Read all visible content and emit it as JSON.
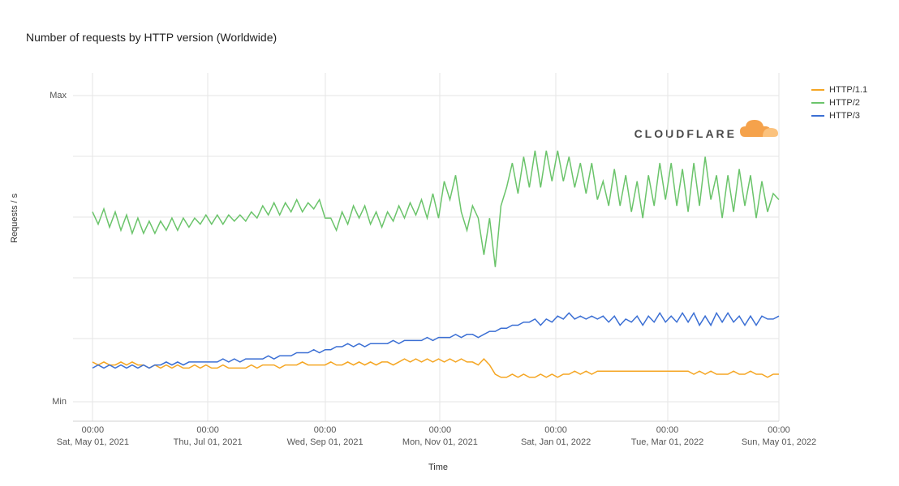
{
  "chart_data": {
    "type": "line",
    "title": "Number of requests by HTTP version (Worldwide)",
    "xlabel": "Time",
    "ylabel": "Requests / s",
    "ylim": [
      0,
      100
    ],
    "y_tick_labels": [
      "Min",
      "Max"
    ],
    "x_tick_labels": [
      {
        "time": "00:00",
        "date": "Sat, May 01, 2021"
      },
      {
        "time": "00:00",
        "date": "Thu, Jul 01, 2021"
      },
      {
        "time": "00:00",
        "date": "Wed, Sep 01, 2021"
      },
      {
        "time": "00:00",
        "date": "Mon, Nov 01, 2021"
      },
      {
        "time": "00:00",
        "date": "Sat, Jan 01, 2022"
      },
      {
        "time": "00:00",
        "date": "Tue, Mar 01, 2022"
      },
      {
        "time": "00:00",
        "date": "Sun, May 01, 2022"
      }
    ],
    "series": [
      {
        "name": "HTTP/1.1",
        "color": "#f5a623",
        "values": [
          13,
          12,
          13,
          12,
          12,
          13,
          12,
          13,
          12,
          12,
          11,
          12,
          11,
          12,
          11,
          12,
          11,
          11,
          12,
          11,
          12,
          11,
          11,
          12,
          11,
          11,
          11,
          11,
          12,
          11,
          12,
          12,
          12,
          11,
          12,
          12,
          12,
          13,
          12,
          12,
          12,
          12,
          13,
          12,
          12,
          13,
          12,
          13,
          12,
          13,
          12,
          13,
          13,
          12,
          13,
          14,
          13,
          14,
          13,
          14,
          13,
          14,
          13,
          14,
          13,
          14,
          13,
          13,
          12,
          14,
          12,
          9,
          8,
          8,
          9,
          8,
          9,
          8,
          8,
          9,
          8,
          9,
          8,
          9,
          9,
          10,
          9,
          10,
          9,
          10,
          10,
          10,
          10,
          10,
          10,
          10,
          10,
          10,
          10,
          10,
          10,
          10,
          10,
          10,
          10,
          10,
          9,
          10,
          9,
          10,
          9,
          9,
          9,
          10,
          9,
          9,
          10,
          9,
          9,
          8,
          9,
          9
        ]
      },
      {
        "name": "HTTP/2",
        "color": "#6bc46b",
        "values": [
          62,
          58,
          63,
          57,
          62,
          56,
          61,
          55,
          60,
          55,
          59,
          55,
          59,
          56,
          60,
          56,
          60,
          57,
          60,
          58,
          61,
          58,
          61,
          58,
          61,
          59,
          61,
          59,
          62,
          60,
          64,
          61,
          65,
          61,
          65,
          62,
          66,
          62,
          65,
          63,
          66,
          60,
          60,
          56,
          62,
          58,
          64,
          60,
          64,
          58,
          62,
          57,
          62,
          59,
          64,
          60,
          65,
          61,
          66,
          60,
          68,
          60,
          72,
          66,
          74,
          62,
          56,
          64,
          60,
          48,
          60,
          44,
          64,
          70,
          78,
          68,
          80,
          70,
          82,
          70,
          82,
          72,
          82,
          72,
          80,
          70,
          78,
          68,
          78,
          66,
          72,
          64,
          76,
          64,
          74,
          62,
          72,
          60,
          74,
          64,
          78,
          66,
          78,
          64,
          76,
          62,
          78,
          64,
          80,
          66,
          74,
          60,
          74,
          62,
          76,
          64,
          74,
          60,
          72,
          62,
          68,
          66
        ]
      },
      {
        "name": "HTTP/3",
        "color": "#3b6fd4",
        "values": [
          11,
          12,
          11,
          12,
          11,
          12,
          11,
          12,
          11,
          12,
          11,
          12,
          12,
          13,
          12,
          13,
          12,
          13,
          13,
          13,
          13,
          13,
          13,
          14,
          13,
          14,
          13,
          14,
          14,
          14,
          14,
          15,
          14,
          15,
          15,
          15,
          16,
          16,
          16,
          17,
          16,
          17,
          17,
          18,
          18,
          19,
          18,
          19,
          18,
          19,
          19,
          19,
          19,
          20,
          19,
          20,
          20,
          20,
          20,
          21,
          20,
          21,
          21,
          21,
          22,
          21,
          22,
          22,
          21,
          22,
          23,
          23,
          24,
          24,
          25,
          25,
          26,
          26,
          27,
          25,
          27,
          26,
          28,
          27,
          29,
          27,
          28,
          27,
          28,
          27,
          28,
          26,
          28,
          25,
          27,
          26,
          28,
          25,
          28,
          26,
          29,
          26,
          28,
          26,
          29,
          26,
          29,
          25,
          28,
          25,
          29,
          26,
          29,
          26,
          28,
          25,
          28,
          25,
          28,
          27,
          27,
          28
        ]
      }
    ],
    "legend_entries": [
      "HTTP/1.1",
      "HTTP/2",
      "HTTP/3"
    ],
    "branding": "CLOUDFLARE"
  }
}
